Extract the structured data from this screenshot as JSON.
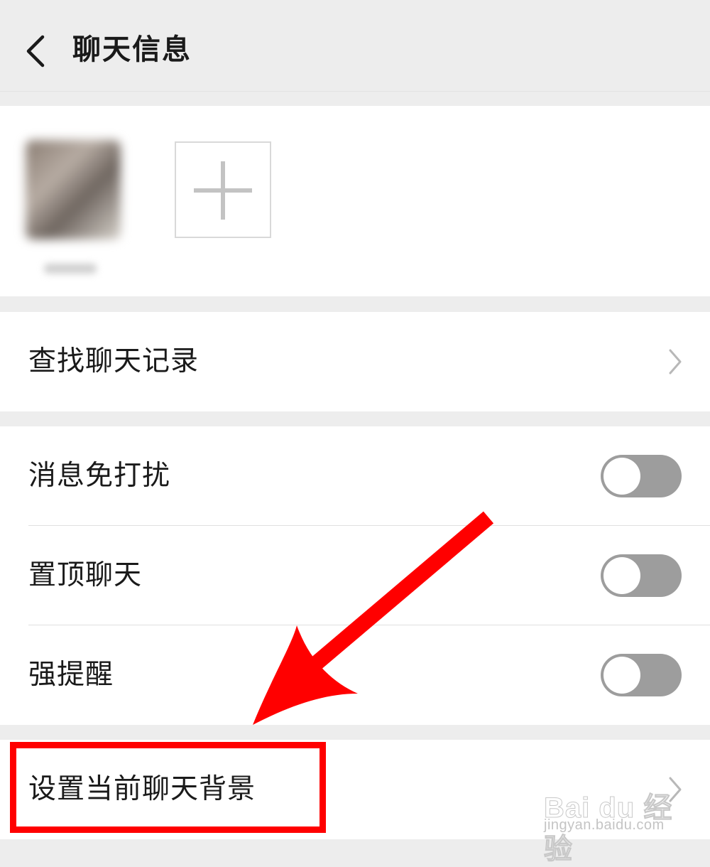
{
  "header": {
    "title": "聊天信息"
  },
  "members": {
    "avatar_alt": "contact-avatar"
  },
  "search_history": {
    "label": "查找聊天记录"
  },
  "settings": [
    {
      "label": "消息免打扰",
      "enabled": false
    },
    {
      "label": "置顶聊天",
      "enabled": false
    },
    {
      "label": "强提醒",
      "enabled": false
    }
  ],
  "chat_background": {
    "label": "设置当前聊天背景"
  },
  "watermark": {
    "brand": "Bai du 经验",
    "url": "jingyan.baidu.com"
  },
  "colors": {
    "annotation_red": "#ff0000",
    "toggle_off": "#9d9d9d",
    "background": "#ededed"
  }
}
